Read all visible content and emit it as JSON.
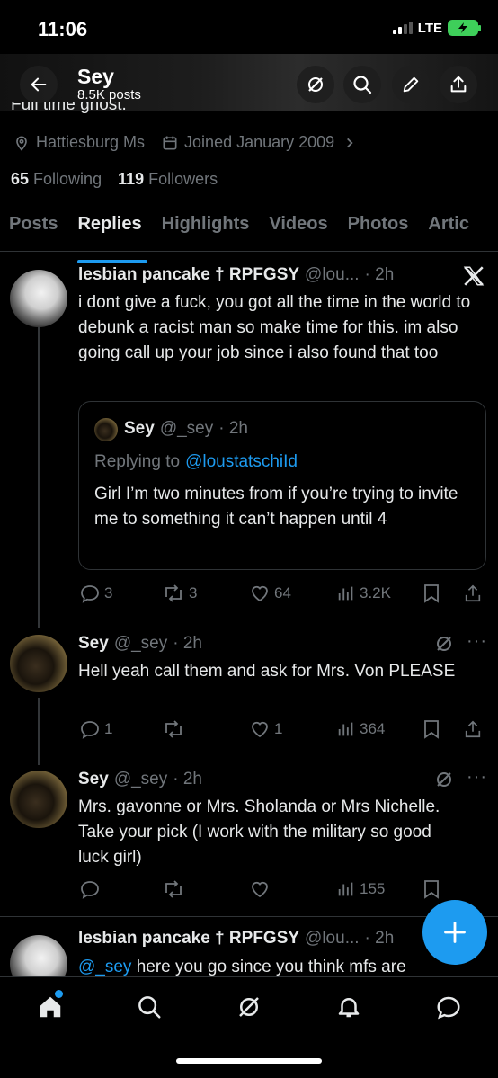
{
  "status": {
    "time": "11:06",
    "network": "LTE"
  },
  "header": {
    "name": "Sey",
    "posts_count": "8.5K posts"
  },
  "profile": {
    "bio_partial": "Full time ghost.",
    "location": "Hattiesburg Ms",
    "joined": "Joined January 2009",
    "following_count": "65",
    "following_label": "Following",
    "followers_count": "119",
    "followers_label": "Followers"
  },
  "tabs": [
    {
      "label": "Posts"
    },
    {
      "label": "Replies"
    },
    {
      "label": "Highlights"
    },
    {
      "label": "Videos"
    },
    {
      "label": "Photos"
    },
    {
      "label": "Artic"
    }
  ],
  "posts": [
    {
      "name": "lesbian pancake † RPFGSY",
      "handle": "@lou...",
      "time": "· 2h",
      "text": "i dont give a fuck, you got all the time in the world to debunk a racist man so make time for this. im also going call up your job since i also found that too",
      "quote": {
        "name": "Sey",
        "handle": "@_sey",
        "time": "· 2h",
        "replying_prefix": "Replying to",
        "replying_to": "@loustatschiId",
        "text": "Girl I’m two minutes from if you’re trying to invite me to something it can’t happen until 4"
      },
      "replies": "3",
      "reposts": "3",
      "likes": "64",
      "views": "3.2K"
    },
    {
      "name": "Sey",
      "handle": "@_sey",
      "time": "· 2h",
      "text": "Hell yeah call them and ask for Mrs. Von PLEASE",
      "replies": "1",
      "reposts": "",
      "likes": "1",
      "views": "364"
    },
    {
      "name": "Sey",
      "handle": "@_sey",
      "time": "· 2h",
      "text": "Mrs. gavonne or Mrs. Sholanda or Mrs Nichelle. Take your pick (I work with the military so good luck girl)",
      "replies": "",
      "reposts": "",
      "likes": "",
      "views": "155"
    },
    {
      "name": "lesbian pancake † RPFGSY",
      "handle": "@lou...",
      "time": "· 2h",
      "mention": "@_sey",
      "text": "here you go since you think mfs are"
    }
  ],
  "icons": {
    "back": "arrow-left-icon",
    "grok": "grok-icon",
    "search": "search-icon",
    "edit": "pencil-icon",
    "share": "share-icon",
    "compose": "plus-icon"
  },
  "colors": {
    "accent": "#1d9bf0",
    "background": "#000000",
    "muted": "#71767b"
  }
}
